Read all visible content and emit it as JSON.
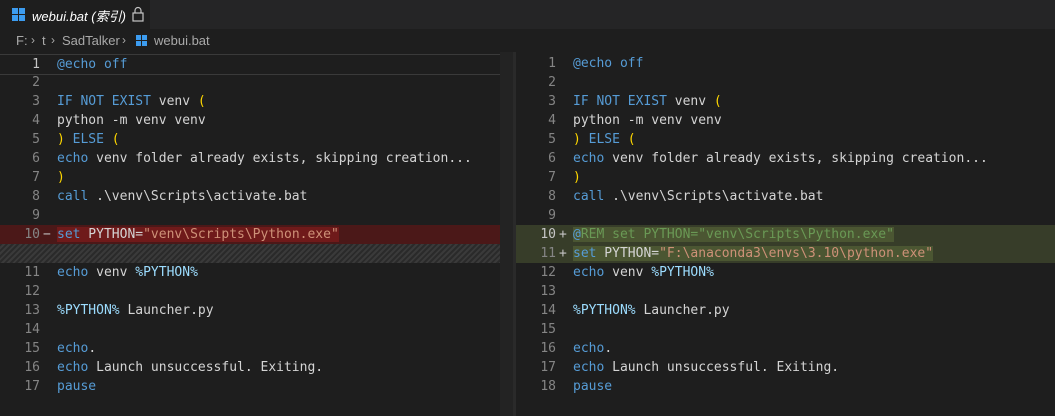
{
  "tab": {
    "title": "webui.bat (索引)",
    "icon": "windows-icon",
    "lock_icon": "lock-icon"
  },
  "breadcrumb": {
    "items": [
      "F:",
      "t",
      "SadTalker",
      "webui.bat"
    ]
  },
  "left": {
    "lines": [
      {
        "n": "1",
        "text": "@echo off"
      },
      {
        "n": "2",
        "text": ""
      },
      {
        "n": "3",
        "text": "IF NOT EXIST venv ("
      },
      {
        "n": "4",
        "text": "python -m venv venv"
      },
      {
        "n": "5",
        "text": ") ELSE ("
      },
      {
        "n": "6",
        "text": "echo venv folder already exists, skipping creation..."
      },
      {
        "n": "7",
        "text": ")"
      },
      {
        "n": "8",
        "text": "call .\\venv\\Scripts\\activate.bat"
      },
      {
        "n": "9",
        "text": ""
      },
      {
        "n": "10",
        "text": "set PYTHON=\"venv\\Scripts\\Python.exe\"",
        "marker": "−"
      },
      {
        "n": "",
        "text": ""
      },
      {
        "n": "11",
        "text": "echo venv %PYTHON%"
      },
      {
        "n": "12",
        "text": ""
      },
      {
        "n": "13",
        "text": "%PYTHON% Launcher.py"
      },
      {
        "n": "14",
        "text": ""
      },
      {
        "n": "15",
        "text": "echo."
      },
      {
        "n": "16",
        "text": "echo Launch unsuccessful. Exiting."
      },
      {
        "n": "17",
        "text": "pause"
      }
    ]
  },
  "right": {
    "lines": [
      {
        "n": "1",
        "text": "@echo off"
      },
      {
        "n": "2",
        "text": ""
      },
      {
        "n": "3",
        "text": "IF NOT EXIST venv ("
      },
      {
        "n": "4",
        "text": "python -m venv venv"
      },
      {
        "n": "5",
        "text": ") ELSE ("
      },
      {
        "n": "6",
        "text": "echo venv folder already exists, skipping creation..."
      },
      {
        "n": "7",
        "text": ")"
      },
      {
        "n": "8",
        "text": "call .\\venv\\Scripts\\activate.bat"
      },
      {
        "n": "9",
        "text": ""
      },
      {
        "n": "10",
        "text": "@REM set PYTHON=\"venv\\Scripts\\Python.exe\"",
        "marker": "+"
      },
      {
        "n": "11",
        "text": "set PYTHON=\"F:\\anaconda3\\envs\\3.10\\python.exe\"",
        "marker": "+"
      },
      {
        "n": "12",
        "text": "echo venv %PYTHON%"
      },
      {
        "n": "13",
        "text": ""
      },
      {
        "n": "14",
        "text": "%PYTHON% Launcher.py"
      },
      {
        "n": "15",
        "text": ""
      },
      {
        "n": "16",
        "text": "echo."
      },
      {
        "n": "17",
        "text": "echo Launch unsuccessful. Exiting."
      },
      {
        "n": "18",
        "text": "pause"
      }
    ]
  }
}
